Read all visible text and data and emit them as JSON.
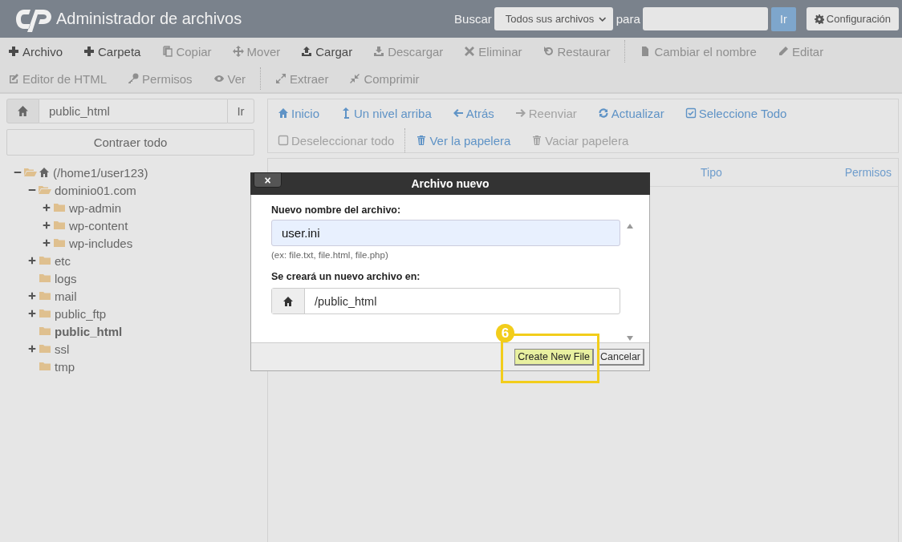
{
  "header": {
    "title": "Administrador de archivos",
    "search_label": "Buscar",
    "scope": "Todos sus archivos",
    "for_label": "para",
    "go": "Ir",
    "settings": "Configuración"
  },
  "toolbar": {
    "buttons": [
      {
        "label": "Archivo",
        "disabled": false
      },
      {
        "label": "Carpeta",
        "disabled": false
      },
      {
        "label": "Copiar",
        "disabled": true
      },
      {
        "label": "Mover",
        "disabled": true
      },
      {
        "label": "Cargar",
        "disabled": false
      },
      {
        "label": "Descargar",
        "disabled": true
      },
      {
        "label": "Eliminar",
        "disabled": true
      },
      {
        "label": "Restaurar",
        "disabled": true
      },
      {
        "label": "Cambiar el nombre",
        "disabled": true,
        "separator": true
      },
      {
        "label": "Editar",
        "disabled": true
      },
      {
        "label": "Editor de HTML",
        "disabled": true
      },
      {
        "label": "Permisos",
        "disabled": true
      },
      {
        "label": "Ver",
        "disabled": true
      },
      {
        "label": "Extraer",
        "disabled": true,
        "separator": true
      },
      {
        "label": "Comprimir",
        "disabled": true
      }
    ]
  },
  "sidebar": {
    "path": "public_html",
    "go": "Ir",
    "collapse": "Contraer todo",
    "tree": [
      {
        "label": "(/home1/user123)",
        "expanded": true,
        "selected": false,
        "children": [
          {
            "label": "dominio01.com",
            "expanded": true,
            "selected": false,
            "children": [
              {
                "label": "wp-admin",
                "expanded": false,
                "selected": false
              },
              {
                "label": "wp-content",
                "expanded": false,
                "selected": false
              },
              {
                "label": "wp-includes",
                "expanded": false,
                "selected": false
              }
            ]
          },
          {
            "label": "etc",
            "expanded": false,
            "selected": false
          },
          {
            "label": "logs",
            "selected": false
          },
          {
            "label": "mail",
            "expanded": false,
            "selected": false
          },
          {
            "label": "public_ftp",
            "expanded": false,
            "selected": false
          },
          {
            "label": "public_html",
            "selected": true
          },
          {
            "label": "ssl",
            "expanded": false,
            "selected": false
          },
          {
            "label": "tmp",
            "selected": false
          }
        ]
      }
    ]
  },
  "navigation": {
    "buttons": [
      {
        "label": "Inicio",
        "disabled": false
      },
      {
        "label": "Un nivel arriba",
        "disabled": false
      },
      {
        "label": "Atrás",
        "disabled": false
      },
      {
        "label": "Reenviar",
        "disabled": true
      },
      {
        "label": "Actualizar",
        "disabled": false
      },
      {
        "label": "Seleccione Todo",
        "disabled": false
      },
      {
        "label": "Deseleccionar todo",
        "disabled": true
      },
      {
        "label": "Ver la papelera",
        "disabled": false,
        "separator": true
      },
      {
        "label": "Vaciar papelera",
        "disabled": true
      }
    ]
  },
  "table": {
    "columns": [
      "Tipo",
      "Permisos"
    ]
  },
  "dialog": {
    "title": "Archivo nuevo",
    "close": "×",
    "name_label": "Nuevo nombre del archivo:",
    "name_value": "user.ini",
    "hint": "(ex: file.txt, file.html, file.php)",
    "location_label": "Se creará un nuevo archivo en:",
    "location_value": "/public_html",
    "buttons": [
      {
        "label": "Create New File",
        "kind": "primary"
      },
      {
        "label": "Cancelar",
        "kind": "secondary"
      }
    ]
  },
  "annotation": {
    "step": "6"
  }
}
